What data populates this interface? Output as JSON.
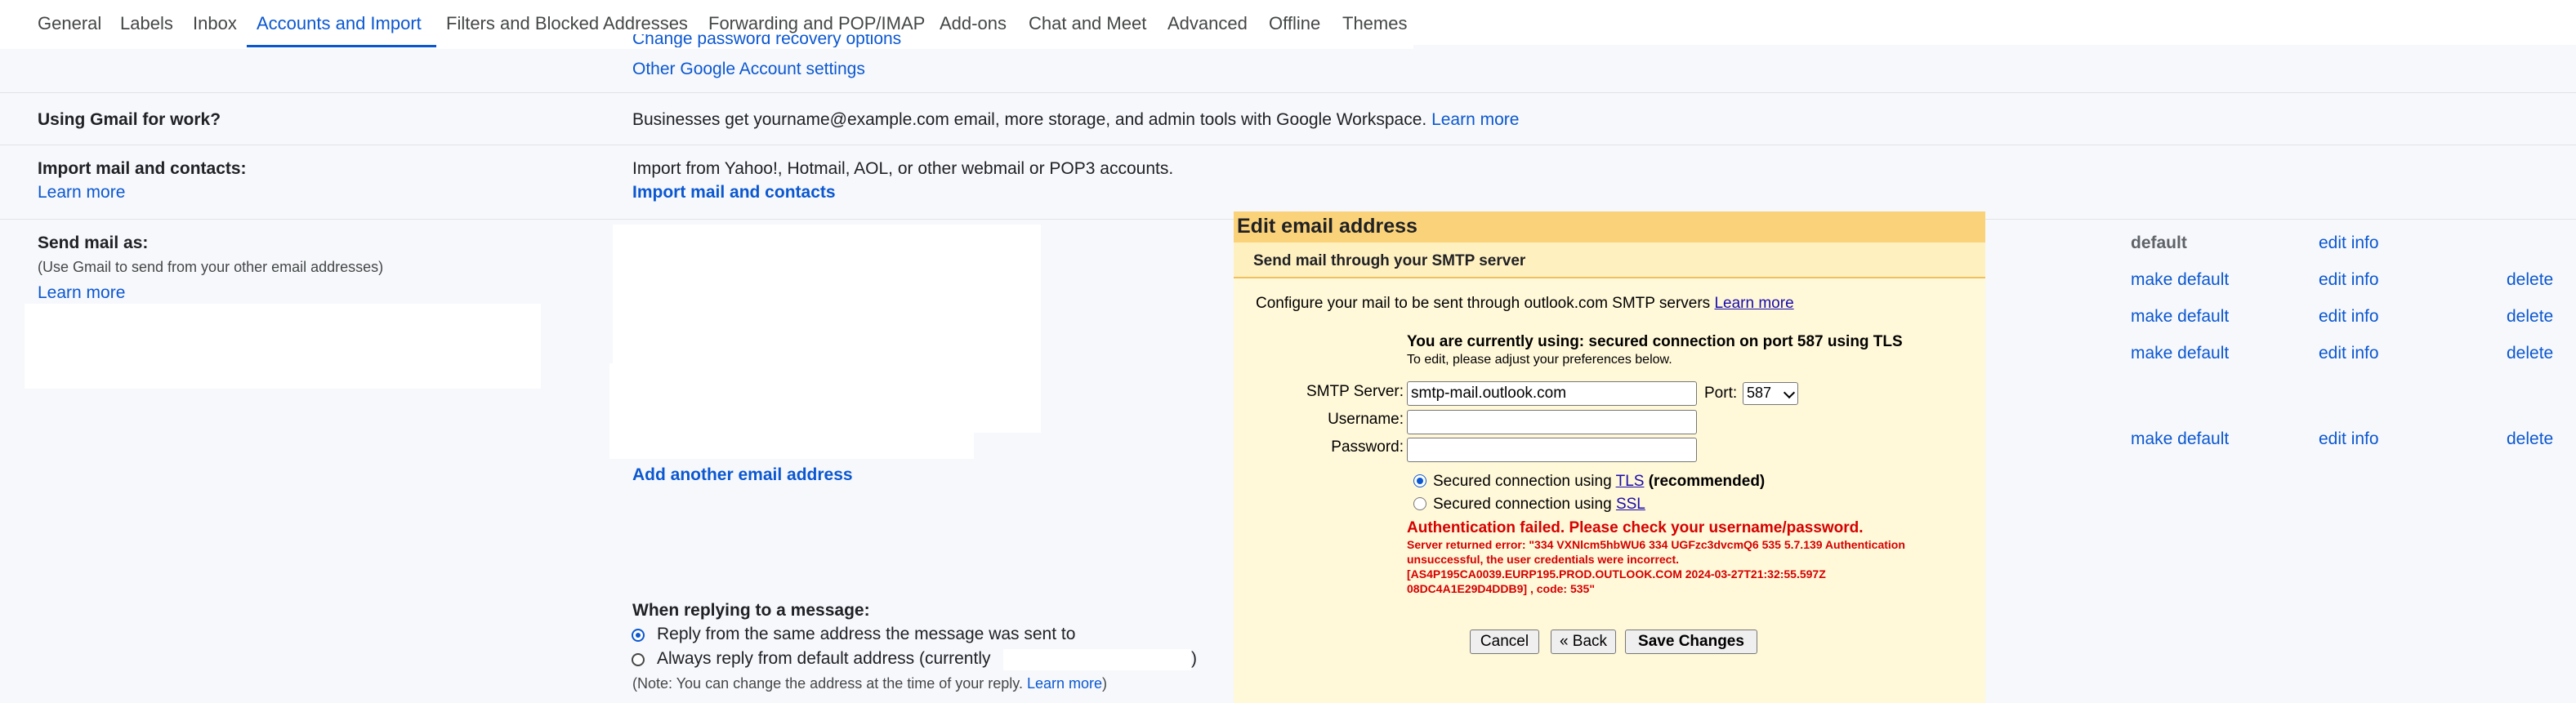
{
  "tabs": [
    {
      "label": "General",
      "active": false
    },
    {
      "label": "Labels",
      "active": false
    },
    {
      "label": "Inbox",
      "active": false
    },
    {
      "label": "Accounts and Import",
      "active": true
    },
    {
      "label": "Filters and Blocked Addresses",
      "active": false
    },
    {
      "label": "Forwarding and POP/IMAP",
      "active": false
    },
    {
      "label": "Add-ons",
      "active": false
    },
    {
      "label": "Chat and Meet",
      "active": false
    },
    {
      "label": "Advanced",
      "active": false
    },
    {
      "label": "Offline",
      "active": false
    },
    {
      "label": "Themes",
      "active": false
    }
  ],
  "change_account": {
    "partial_link": "Change password recovery options",
    "other_settings_link": "Other Google Account settings"
  },
  "work": {
    "label": "Using Gmail for work?",
    "text": "Businesses get yourname@example.com email, more storage, and admin tools with Google Workspace.",
    "link": "Learn more"
  },
  "import": {
    "label": "Import mail and contacts:",
    "learn_more": "Learn more",
    "text": "Import from Yahoo!, Hotmail, AOL, or other webmail or POP3 accounts.",
    "action_link": "Import mail and contacts"
  },
  "send_as": {
    "label": "Send mail as:",
    "note": "(Use Gmail to send from your other email addresses)",
    "learn_more": "Learn more",
    "add_link": "Add another email address",
    "rows": [
      {
        "status": "default",
        "edit": "edit info"
      },
      {
        "make_default": "make default",
        "edit": "edit info",
        "delete": "delete"
      },
      {
        "make_default": "make default",
        "edit": "edit info",
        "delete": "delete"
      },
      {
        "make_default": "make default",
        "edit": "edit info",
        "delete": "delete"
      },
      {
        "make_default": "make default",
        "edit": "edit info",
        "delete": "delete"
      }
    ]
  },
  "reply": {
    "label": "When replying to a message:",
    "option_same": "Reply from the same address the message was sent to",
    "option_default": "Always reply from default address (currently",
    "option_default_close": ")",
    "note_prefix": "(Note: You can change the address at the time of your reply.",
    "note_link": "Learn more",
    "note_suffix": ")",
    "selected": "same"
  },
  "dialog": {
    "title": "Edit email address",
    "subtitle": "Send mail through your SMTP server",
    "configure_text": "Configure your mail to be sent through outlook.com SMTP servers",
    "configure_link": "Learn more",
    "current_status": "You are currently using: secured connection on port 587 using TLS",
    "adjust_hint": "To edit, please adjust your preferences below.",
    "smtp_label": "SMTP Server:",
    "smtp_value": "smtp-mail.outlook.com",
    "port_label": "Port:",
    "port_value": "587",
    "username_label": "Username:",
    "username_value": "",
    "password_label": "Password:",
    "password_value": "",
    "tls_prefix": "Secured connection using",
    "tls_link": "TLS",
    "tls_suffix": "(recommended)",
    "ssl_prefix": "Secured connection using",
    "ssl_link": "SSL",
    "selected_security": "TLS",
    "error_title": "Authentication failed. Please check your username/password.",
    "error_lines": [
      "Server returned error: \"334 VXNlcm5hbWU6 334 UGFzc3dvcmQ6 535 5.7.139 Authentication",
      "unsuccessful, the user credentials were incorrect.",
      "[AS4P195CA0039.EURP195.PROD.OUTLOOK.COM 2024-03-27T21:32:55.597Z",
      "08DC4A1E29D4DDB9] , code: 535\""
    ],
    "cancel_label": "Cancel",
    "back_label": "« Back",
    "save_label": "Save Changes"
  },
  "colors": {
    "accent": "#0b57d0",
    "dialog_title_bg": "#fad27a",
    "dialog_bg": "#fff8d9",
    "error": "#d50000"
  }
}
